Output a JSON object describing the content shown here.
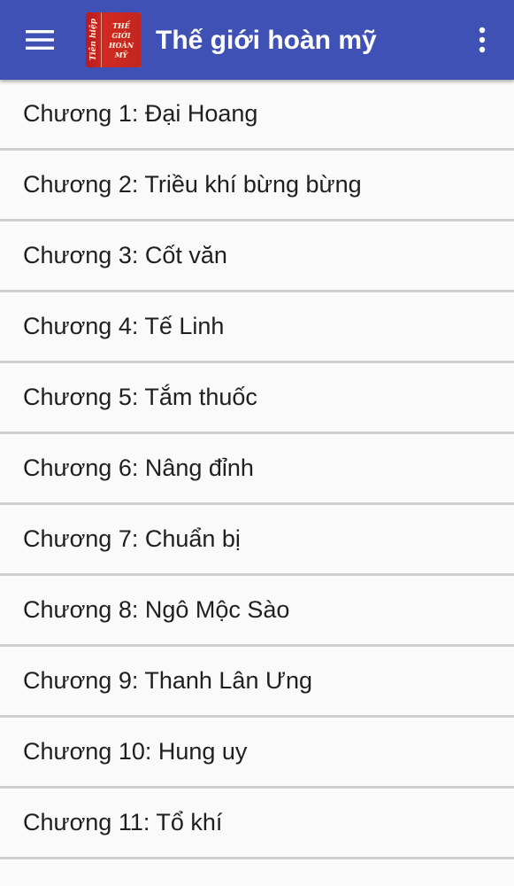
{
  "appbar": {
    "title": "Thế giới hoàn mỹ",
    "menu_icon": "hamburger-icon",
    "more_icon": "more-vert-icon",
    "logo": {
      "side_text": "Tiên hiệp",
      "lines": [
        "THẾ",
        "GIỚI",
        "HOÀN",
        "MỸ"
      ]
    },
    "colors": {
      "bar": "#3f51b5",
      "text": "#ffffff"
    }
  },
  "chapters": [
    "Chương 1: Đại Hoang",
    "Chương 2: Triều khí bừng bừng",
    "Chương 3: Cốt văn",
    "Chương 4: Tế Linh",
    "Chương 5: Tắm thuốc",
    "Chương 6: Nâng đỉnh",
    "Chương 7: Chuẩn bị",
    "Chương 8: Ngô Mộc Sào",
    "Chương 9: Thanh Lân Ưng",
    "Chương 10: Hung uy",
    "Chương 11: Tổ khí"
  ]
}
